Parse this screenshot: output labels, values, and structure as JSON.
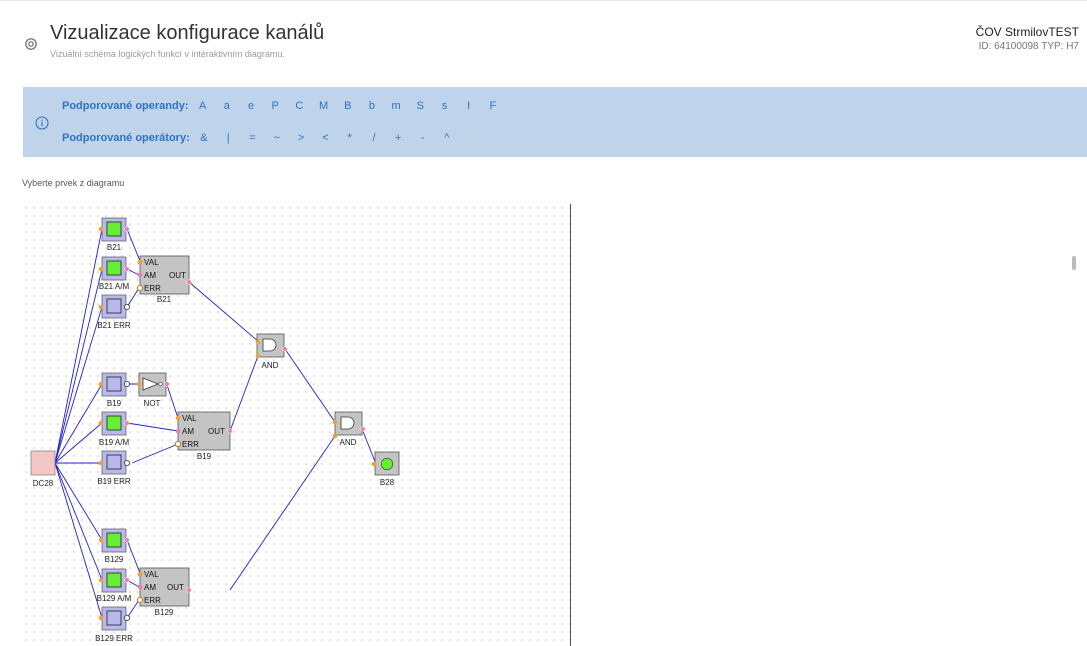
{
  "header": {
    "title": "Vizualizace konfigurace kanálů",
    "subtitle": "Vizuální schéma logických funkcí v interaktivním diagramu.",
    "site_name": "ČOV StrmilovTEST",
    "site_id_line": "ID: 64100098   TYP: H7"
  },
  "banner": {
    "operands_label": "Podporované operandy:",
    "operands": [
      "A",
      "a",
      "e",
      "P",
      "C",
      "M",
      "B",
      "b",
      "m",
      "S",
      "s",
      "I",
      "F"
    ],
    "operators_label": "Podporované operátory:",
    "operators": [
      "&",
      "|",
      "=",
      "~",
      ">",
      "<",
      "*",
      "/",
      "+",
      "-",
      "^"
    ]
  },
  "hint": "Vyberte prvek z diagramu",
  "diagram": {
    "labels": {
      "b21": "B21",
      "b21_am": "B21 A/M",
      "b21_err": "B21 ERR",
      "b21_block": "B21",
      "b19": "B19",
      "not": "NOT",
      "b19_am": "B19 A/M",
      "b19_err": "B19 ERR",
      "b19_block": "B19",
      "dc28": "DC28",
      "and1": "AND",
      "and2": "AND",
      "b28": "B28",
      "b129": "B129",
      "b129_am": "B129 A/M",
      "b129_err": "B129 ERR",
      "b129_block": "B129"
    },
    "ports": {
      "val": "VAL",
      "am": "AM",
      "out": "OUT",
      "err": "ERR"
    },
    "colors": {
      "wire": "#2222cc",
      "node_purple": "#b8b8ea",
      "node_green": "#66ee33",
      "block_gray": "#c4c4c4",
      "source_pink": "#f4c6c6",
      "port_orange": "#f0a030",
      "port_pink": "#f27ea6"
    }
  }
}
